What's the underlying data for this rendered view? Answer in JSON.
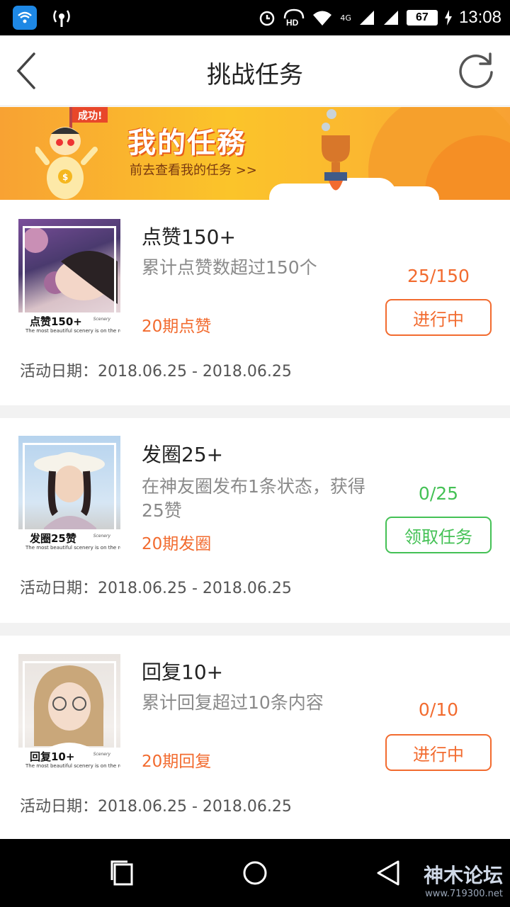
{
  "status_bar": {
    "time": "13:08",
    "battery": "67",
    "network": "4G"
  },
  "header": {
    "title": "挑战任务"
  },
  "banner": {
    "title": "我的任務",
    "subtitle": "前去查看我的任务 >>",
    "flag": "成功!"
  },
  "tasks": [
    {
      "title": "点赞150+",
      "desc": "累计点赞数超过150个",
      "period": "20期点赞",
      "progress": "25/150",
      "status": "进行中",
      "date": "活动日期：2018.06.25 - 2018.06.25",
      "thumb_caption": "点赞150+",
      "thumb_slogan": "The most beautiful scenery is on the road",
      "thumb_tag": "Scenery"
    },
    {
      "title": "发圈25+",
      "desc": "在神友圈发布1条状态，获得25赞",
      "period": "20期发圈",
      "progress": "0/25",
      "status": "领取任务",
      "date": "活动日期：2018.06.25 - 2018.06.25",
      "thumb_caption": "发圈25赞",
      "thumb_slogan": "The most beautiful scenery is on the road",
      "thumb_tag": "Scenery"
    },
    {
      "title": "回复10+",
      "desc": "累计回复超过10条内容",
      "period": "20期回复",
      "progress": "0/10",
      "status": "进行中",
      "date": "活动日期：2018.06.25 - 2018.06.25",
      "thumb_caption": "回复10+",
      "thumb_slogan": "The most beautiful scenery is on the road",
      "thumb_tag": "Scenery"
    }
  ],
  "watermark": {
    "name": "神木论坛",
    "url": "www.719300.net"
  },
  "colors": {
    "accent_orange": "#f26b2f",
    "accent_green": "#44c155",
    "banner_yellow": "#fbc42a"
  }
}
